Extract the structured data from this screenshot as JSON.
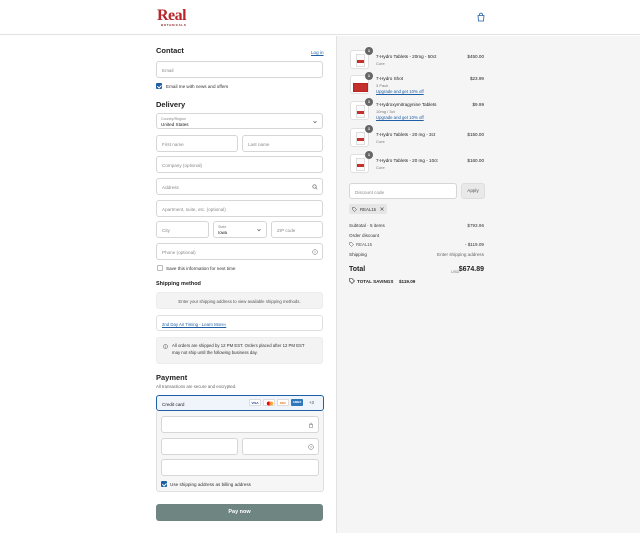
{
  "brand": {
    "name": "Real",
    "tagline": "BOTANICALS"
  },
  "contact": {
    "heading": "Contact",
    "login": "Log in",
    "email_placeholder": "Email",
    "newsletter_label": "Email me with news and offers"
  },
  "delivery": {
    "heading": "Delivery",
    "country_label": "Country/Region",
    "country_value": "United States",
    "first_name": "First name",
    "last_name": "Last name",
    "company": "Company (optional)",
    "address": "Address",
    "apartment": "Apartment, suite, etc. (optional)",
    "city": "City",
    "state_label": "State",
    "state_value": "Iowa",
    "zip": "ZIP code",
    "phone": "Phone (optional)",
    "save_info": "Save this information for next time"
  },
  "shipping": {
    "heading": "Shipping method",
    "notice": "Enter your shipping address to view available shipping methods.",
    "air_link": "2nd Day Air Timing - Learn More»",
    "info_line1": "All orders are shipped by 12 PM EST. Orders placed after 12 PM EST",
    "info_line2": "may not ship until the following business day."
  },
  "payment": {
    "heading": "Payment",
    "subtitle": "All transactions are secure and encrypted.",
    "method": "Credit card",
    "cards": [
      "VISA",
      "MC",
      "DISC",
      "AMEX"
    ],
    "more_cards": "+3",
    "billing_label": "Use shipping address as billing address",
    "pay_button": "Pay now"
  },
  "cart": {
    "items": [
      {
        "qty": "1",
        "name": "7-Hydro Tablets - 20mg - 50ct",
        "variant": "Core",
        "price": "$450.00",
        "link": ""
      },
      {
        "qty": "1",
        "name": "7-Hydro Shot",
        "variant": "3 Pack",
        "price": "$23.99",
        "link": "Upgrade and get 10% off"
      },
      {
        "qty": "1",
        "name": "7-Hydroxymitragynine Tablets",
        "variant": "10mg / 3ct",
        "price": "$9.99",
        "link": "Upgrade and get 10% off"
      },
      {
        "qty": "1",
        "name": "7-Hydro Tablets - 20 mg - 3ct",
        "variant": "Core",
        "price": "$150.00",
        "link": ""
      },
      {
        "qty": "1",
        "name": "7-Hydro Tablets - 20 mg - 10ct",
        "variant": "Core",
        "price": "$160.00",
        "link": ""
      }
    ],
    "discount_placeholder": "Discount code",
    "apply": "Apply",
    "applied_code": "REAL15",
    "subtotal_label": "Subtotal · 5 items",
    "subtotal_value": "$793.96",
    "order_discount_label": "Order discount",
    "order_discount_code": "REAL15",
    "order_discount_value": "- $119.09",
    "shipping_label": "Shipping",
    "shipping_value": "Enter shipping address",
    "total_label": "Total",
    "currency": "USD",
    "total_value": "$674.89",
    "savings_label": "TOTAL SAVINGS",
    "savings_value": "$119.09"
  }
}
